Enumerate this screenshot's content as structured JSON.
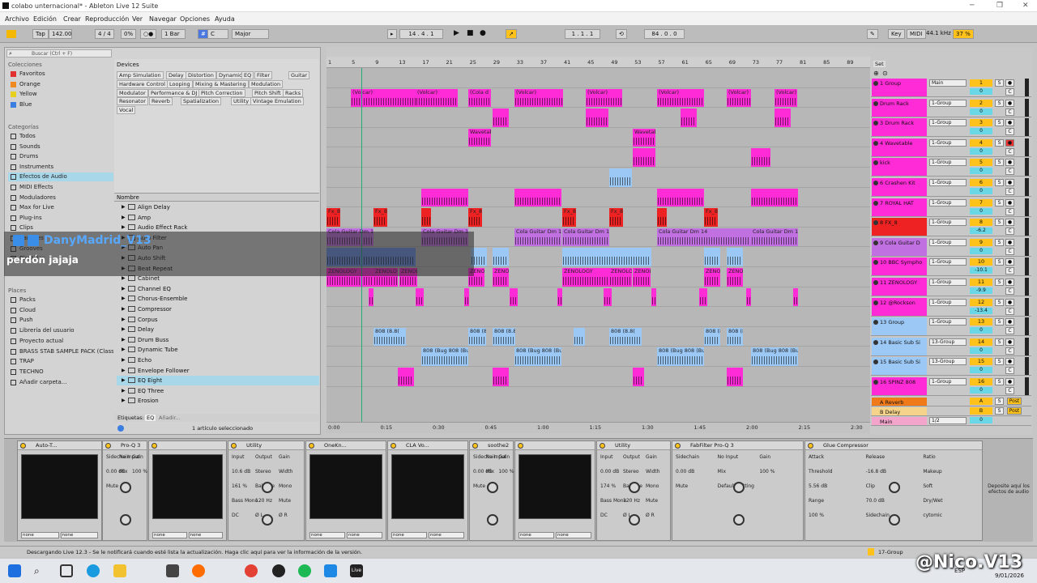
{
  "window": {
    "title": "colabo unternacional* - Ableton Live 12 Suite"
  },
  "menu": [
    "Archivo",
    "Edición",
    "Crear",
    "Reproducción",
    "Ver",
    "Navegar",
    "Opciones",
    "Ayuda"
  ],
  "control": {
    "tap": "Tap",
    "tempo": "142.00",
    "signature": "4 / 4",
    "groove": "0%",
    "metro": "1 Bar",
    "key": "C",
    "scale": "Major",
    "position": "14 . 4 . 1",
    "loop_start": "1 . 1 . 1",
    "loop_len": "84 . 0 . 0",
    "key_label": "Key",
    "midi_label": "MIDI",
    "sample_rate": "44.1 kHz",
    "cpu": "37 %"
  },
  "browser": {
    "search_placeholder": "Buscar (Ctrl + F)",
    "collections_title": "Colecciones",
    "collections": [
      {
        "label": "Favoritos",
        "color": "#e03030"
      },
      {
        "label": "Orange",
        "color": "#f08a20"
      },
      {
        "label": "Yellow",
        "color": "#e8d020"
      },
      {
        "label": "Blue",
        "color": "#3a7ee0"
      }
    ],
    "categories_title": "Categorías",
    "categories": [
      "Todos",
      "Sounds",
      "Drums",
      "Instruments",
      "Efectos de Audio",
      "MIDI Effects",
      "Moduladores",
      "Max for Live",
      "Plug-ins",
      "Clips",
      "Samples",
      "Grooves",
      "Plantillas"
    ],
    "places_title": "Places",
    "places": [
      "Packs",
      "Cloud",
      "Push",
      "Librería del usuario",
      "Proyecto actual",
      "BRASS STAB SAMPLE PACK (Class-",
      "TRAP",
      "TECHNO",
      "Añadir carpeta..."
    ],
    "devices_title": "Devices",
    "device_tags": [
      [
        "Amp Simulation",
        "Delay",
        "Distortion",
        "Dynamics",
        "EQ",
        "Filter",
        "Guitar"
      ],
      [
        "Hardware Control",
        "Looping",
        "Mixing & Mastering",
        "Modulation"
      ],
      [
        "Modulator",
        "Performance & DJ",
        "Pitch Correction",
        "Pitch Shift",
        "Racks"
      ],
      [
        "Resonator",
        "Reverb",
        "Spatialization",
        "Utility",
        "Vintage Emulation"
      ],
      [
        "Vocal"
      ]
    ],
    "name_header": "Nombre",
    "names": [
      "Align Delay",
      "Amp",
      "Audio Effect Rack",
      "Auto Filter",
      "Auto Pan",
      "Auto Shift",
      "Beat Repeat",
      "Cabinet",
      "Channel EQ",
      "Chorus-Ensemble",
      "Compressor",
      "Corpus",
      "Delay",
      "Drum Buss",
      "Dynamic Tube",
      "Echo",
      "Envelope Follower",
      "EQ Eight",
      "EQ Three",
      "Erosion"
    ],
    "tags_label": "Etiquetas:",
    "tags_value": "EQ",
    "tags_add": "Añadir...",
    "selected_text": "1 artículo seleccionado"
  },
  "ruler": [
    "1",
    "5",
    "9",
    "13",
    "17",
    "21",
    "25",
    "29",
    "33",
    "37",
    "41",
    "45",
    "49",
    "53",
    "57",
    "61",
    "65",
    "69",
    "73",
    "77",
    "81",
    "85",
    "89"
  ],
  "time_axis": [
    "0:00",
    "0:15",
    "0:30",
    "0:45",
    "1:00",
    "1:15",
    "1:30",
    "1:45",
    "2:00",
    "2:15",
    "2:30"
  ],
  "clip_names": {
    "volcar": "(Volcar)",
    "cola": "(Cola d",
    "wavetable": "Wavetabl",
    "fx": "Fx_8",
    "guitar": "Cola Guitar Dm 14",
    "zeno": "ZENOLOGY",
    "zeno2": "ZENOLO",
    "zeno3": "ZENOI",
    "b808": "808 (8.8(",
    "b808b": "808 (Bug 808 (Bug"
  },
  "tracks": [
    {
      "name": "1 Group",
      "color": "#ff2bd6",
      "route": "Main",
      "num": "1",
      "vol": "0",
      "n": 1
    },
    {
      "name": "Drum Rack",
      "color": "#ff2bd6",
      "route": "1-Group",
      "num": "2",
      "vol": "0"
    },
    {
      "name": "3 Drum Rack",
      "color": "#ff2bd6",
      "route": "1-Group",
      "num": "3",
      "vol": "0"
    },
    {
      "name": "4 Wavetable",
      "color": "#ff2bd6",
      "route": "1-Group",
      "num": "4",
      "vol": "0"
    },
    {
      "name": "kick",
      "color": "#ff2bd6",
      "route": "1-Group",
      "num": "5",
      "vol": "0"
    },
    {
      "name": "6 Crashen Kit",
      "color": "#ff2bd6",
      "route": "1-Group",
      "num": "6",
      "vol": "0"
    },
    {
      "name": "7 ROYAL HAT",
      "color": "#ff2bd6",
      "route": "1-Group",
      "num": "7",
      "vol": "0"
    },
    {
      "name": "8 FX_8",
      "color": "#ee2222",
      "route": "1-Group",
      "num": "8",
      "vol": "-6.2"
    },
    {
      "name": "9 Cola Guitar D",
      "color": "#c070e0",
      "route": "1-Group",
      "num": "9",
      "vol": "0"
    },
    {
      "name": "10 BBC Sympho",
      "color": "#ff2bd6",
      "route": "1-Group",
      "num": "10",
      "vol": "-10.1"
    },
    {
      "name": "11 ZENOLOGY",
      "color": "#ff2bd6",
      "route": "1-Group",
      "num": "11",
      "vol": "-9.9"
    },
    {
      "name": "12 @Rockson",
      "color": "#ff2bd6",
      "route": "1-Group",
      "num": "12",
      "vol": "-13.4"
    },
    {
      "name": "13 Group",
      "color": "#9cc8f5",
      "route": "1-Group",
      "num": "13",
      "vol": "0"
    },
    {
      "name": "14 Basic Sub Si",
      "color": "#9cc8f5",
      "route": "13-Group",
      "num": "14",
      "vol": "0"
    },
    {
      "name": "15 Basic Sub Si",
      "color": "#9cc8f5",
      "route": "13-Group",
      "num": "15",
      "vol": "0"
    },
    {
      "name": "16 SPINZ 808",
      "color": "#ff2bd6",
      "route": "1-Group",
      "num": "16",
      "vol": "0"
    }
  ],
  "returns": [
    {
      "name": "A Reverb",
      "num": "A",
      "color": "#f07a1a",
      "post": "Post"
    },
    {
      "name": "B Delay",
      "num": "B",
      "color": "#f5d38a",
      "post": "Post"
    }
  ],
  "master": {
    "name": "Main",
    "route": "1/2",
    "vol": "0"
  },
  "devices": [
    {
      "title": "Auto-T...",
      "labels": [
        "none",
        "none"
      ]
    },
    {
      "title": "Pro-Q 3",
      "labels": [
        "Sidechain",
        "No Input",
        "Gain",
        "0.00 dB",
        "Mix",
        "100 %",
        "Mute"
      ]
    },
    {
      "title": "",
      "labels": [
        "none",
        "none"
      ]
    },
    {
      "title": "Utility",
      "labels": [
        "Input",
        "Output",
        "Gain",
        "10.6 dB",
        "Stereo",
        "Width",
        "161 %",
        "Balance",
        "Mono",
        "Bass Mono",
        "120 Hz",
        "Mute",
        "DC",
        "Ø L",
        "Ø R"
      ]
    },
    {
      "title": "OneKn...",
      "labels": [
        "none",
        "none"
      ]
    },
    {
      "title": "CLA Vo...",
      "labels": [
        "none",
        "none"
      ]
    },
    {
      "title": "soothe2",
      "labels": [
        "Sidechain",
        "No Input",
        "Gain",
        "0.00 dB",
        "Mix",
        "100 %",
        "Mute"
      ]
    },
    {
      "title": "",
      "labels": [
        "none",
        "none"
      ]
    },
    {
      "title": "Utility",
      "labels": [
        "Input",
        "Output",
        "Gain",
        "0.00 dB",
        "Stereo",
        "Width",
        "174 %",
        "Balance",
        "Mono",
        "Bass Mono",
        "120 Hz",
        "Mute",
        "DC",
        "Ø L",
        "Ø R"
      ]
    },
    {
      "title": "FabFilter Pro-Q 3",
      "labels": [
        "Sidechain",
        "No Input",
        "Gain",
        "0.00 dB",
        "Mix",
        "100 %",
        "Mute",
        "Default Setting"
      ]
    },
    {
      "title": "Glue Compressor",
      "labels": [
        "Attack",
        "Release",
        "Ratio",
        "Threshold",
        "-16.8 dB",
        "Makeup",
        "5.56 dB",
        "Clip",
        "Soft",
        "Range",
        "70.0 dB",
        "Dry/Wet",
        "100 %",
        "Sidechain",
        "cytomic"
      ]
    }
  ],
  "drop_hint": "Deposite aquí los efectos de audio",
  "status": {
    "text": "Descargando Live 12.3 - Se le notificará cuando esté lista la actualización. Haga clic aquí para ver la información de la versión.",
    "track": "17-Group"
  },
  "chat": {
    "user": "DanyMadrid_V13",
    "message": "perdón jajaja"
  },
  "watermark": "@Nico.V13",
  "taskbar": {
    "lang": "ESP",
    "date": "9/01/2026"
  },
  "colors": {
    "magenta": "#ff2bd6",
    "red": "#ee2222",
    "lavender": "#c070e0",
    "blue": "#9cc8f5",
    "yellow": "#ffc21a",
    "cyan": "#6ad7e6"
  }
}
